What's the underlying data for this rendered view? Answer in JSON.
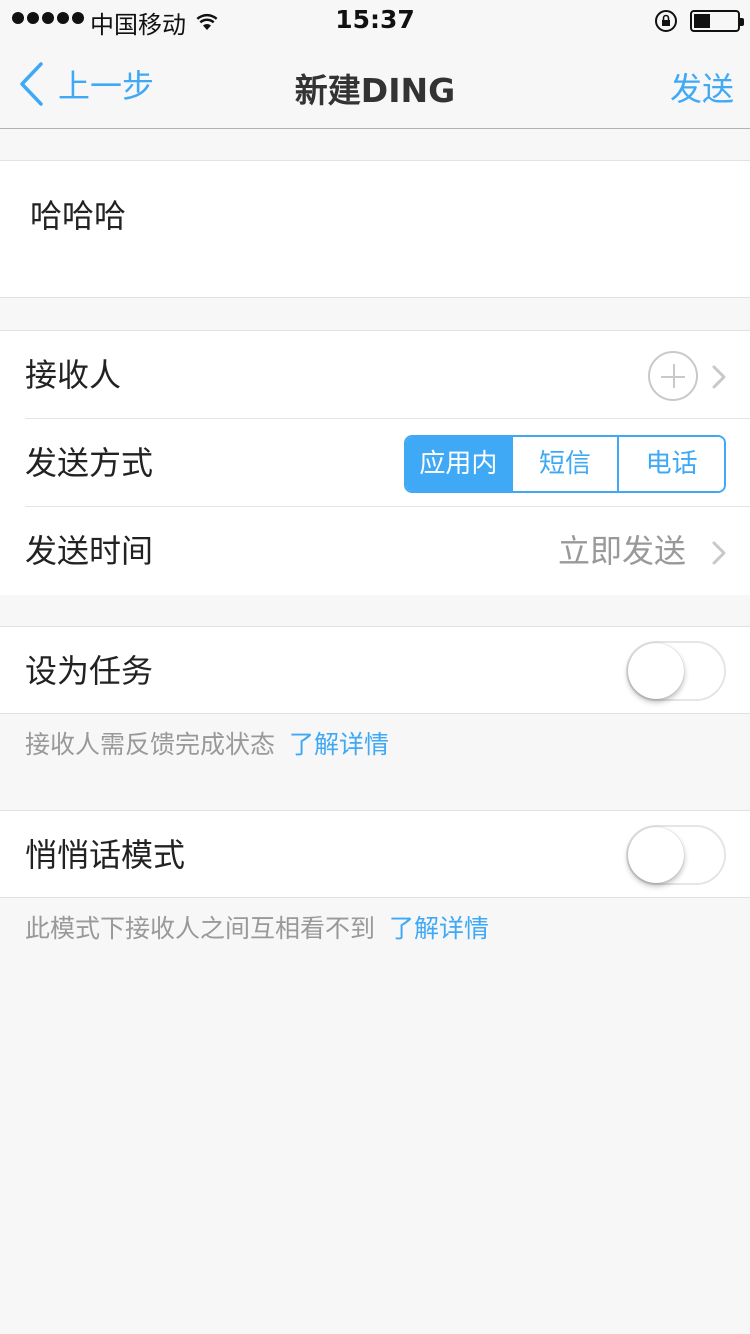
{
  "status_bar": {
    "carrier": "中国移动",
    "time": "15:37"
  },
  "nav": {
    "back_label": "上一步",
    "title": "新建DING",
    "send_label": "发送"
  },
  "message": {
    "text": "哈哈哈"
  },
  "recipient": {
    "label": "接收人"
  },
  "send_method": {
    "label": "发送方式",
    "options": [
      "应用内",
      "短信",
      "电话"
    ],
    "selected": "应用内"
  },
  "send_time": {
    "label": "发送时间",
    "value": "立即发送"
  },
  "task": {
    "label": "设为任务",
    "enabled": false,
    "note": "接收人需反馈完成状态",
    "link": "了解详情"
  },
  "whisper": {
    "label": "悄悄话模式",
    "enabled": false,
    "note": "此模式下接收人之间互相看不到",
    "link": "了解详情"
  },
  "colors": {
    "accent": "#3fa9f5",
    "background": "#f7f7f7"
  }
}
